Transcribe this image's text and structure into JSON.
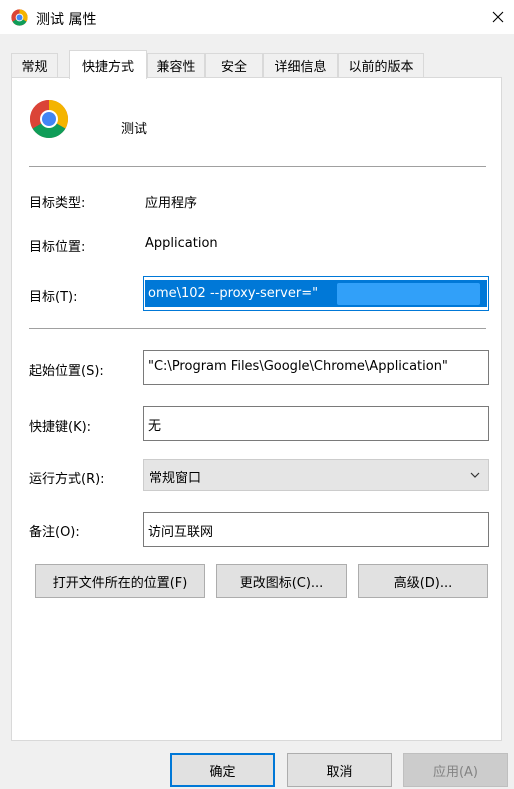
{
  "window": {
    "title": "测试 属性"
  },
  "tabs": [
    {
      "label": "常规"
    },
    {
      "label": "快捷方式"
    },
    {
      "label": "兼容性"
    },
    {
      "label": "安全"
    },
    {
      "label": "详细信息"
    },
    {
      "label": "以前的版本"
    }
  ],
  "active_tab": "快捷方式",
  "shortcut": {
    "name": "测试",
    "target_type_label": "目标类型:",
    "target_type_value": "应用程序",
    "target_location_label": "目标位置:",
    "target_location_value": "Application",
    "target_label": "目标(T):",
    "target_value": "ome\\102 --proxy-server=\"",
    "target_selected": true,
    "start_in_label": "起始位置(S):",
    "start_in_value": "\"C:\\Program Files\\Google\\Chrome\\Application\"",
    "hotkey_label": "快捷键(K):",
    "hotkey_value": "无",
    "run_label": "运行方式(R):",
    "run_value": "常规窗口",
    "comment_label": "备注(O):",
    "comment_value": "访问互联网"
  },
  "actions": {
    "open_location": "打开文件所在的位置(F)",
    "change_icon": "更改图标(C)...",
    "advanced": "高级(D)..."
  },
  "footer": {
    "ok": "确定",
    "cancel": "取消",
    "apply": "应用(A)",
    "apply_enabled": false
  },
  "colors": {
    "accent": "#0078d7",
    "panel_bg": "#ffffff",
    "window_bg": "#f0f0f0"
  },
  "icons": {
    "app": "chrome-icon",
    "close": "close-icon",
    "dropdown": "chevron-down-icon"
  }
}
